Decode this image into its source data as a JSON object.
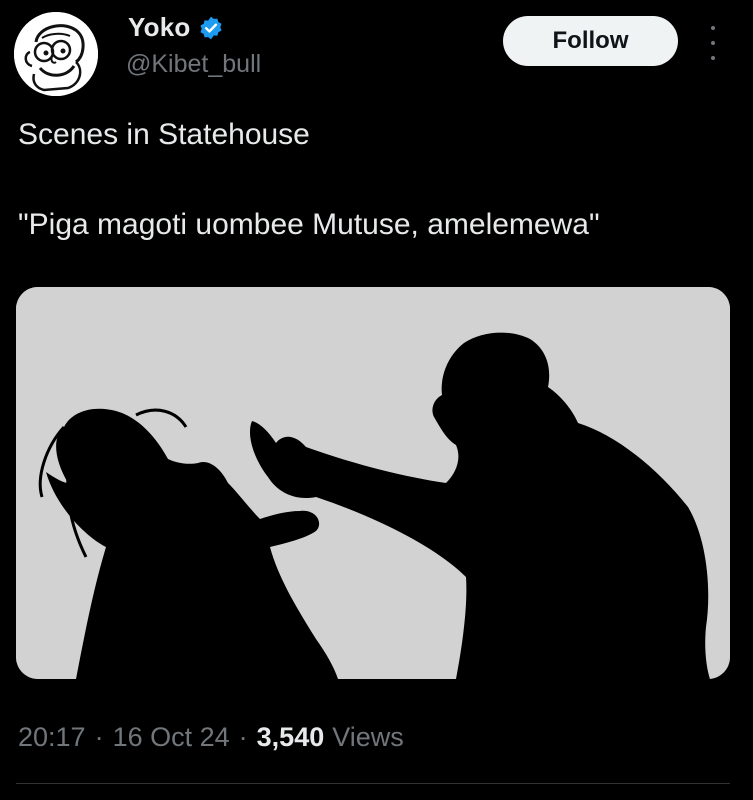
{
  "author": {
    "display_name": "Yoko",
    "handle": "@Kibet_bull",
    "verified": true,
    "verified_color": "#1d9bf0",
    "avatar_icon": "cartoon-avatar"
  },
  "follow_button": {
    "label": "Follow"
  },
  "more_menu": {
    "icon": "more-options-icon"
  },
  "tweet": {
    "lines": [
      "Scenes in Statehouse",
      "\"Piga magoti uombee Mutuse, amelemewa\""
    ]
  },
  "media": {
    "description_icon": "silhouette-image",
    "background_color": "#d2d2d2"
  },
  "meta": {
    "time": "20:17",
    "separator": "·",
    "date": "16 Oct 24",
    "views_count": "3,540",
    "views_label": "Views"
  },
  "colors": {
    "background": "#000000",
    "text_primary": "#e7e9ea",
    "text_secondary": "#71767b",
    "button_bg": "#eff3f4"
  }
}
